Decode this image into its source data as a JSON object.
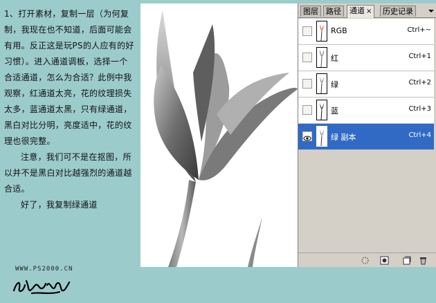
{
  "tutorial": {
    "para1": "1、打开素材，复制一层（为何复制，我现在也不知道，后面可能会有用。反正这是玩PS的人应有的好习惯）。进入通道调板，选择一个合适通道，怎么为合适？此例中我观察，红通道太亮，花的纹理损失太多，蓝通道太黑，只有绿通道，黑白对比分明，亮度适中，花的纹理也很完整。",
    "para2": "注意，我们可不是在抠图，所以并不是黑白对比越强烈的通道越合适。",
    "para3": "好了，我复制绿通道"
  },
  "watermark": "WWW.PS2000.CN",
  "panel": {
    "tabs": [
      "图层",
      "路径",
      "通道",
      "历史记录"
    ],
    "active_tab": "通道",
    "close_glyph": "×",
    "channels": [
      {
        "name": "RGB",
        "shortcut": "Ctrl+~",
        "visible": false,
        "selected": false,
        "thumb": "color"
      },
      {
        "name": "红",
        "shortcut": "Ctrl+1",
        "visible": false,
        "selected": false,
        "thumb": "light"
      },
      {
        "name": "绿",
        "shortcut": "Ctrl+2",
        "visible": false,
        "selected": false,
        "thumb": "gray"
      },
      {
        "name": "蓝",
        "shortcut": "Ctrl+3",
        "visible": false,
        "selected": false,
        "thumb": "dark"
      },
      {
        "name": "绿 副本",
        "shortcut": "Ctrl+4",
        "visible": true,
        "selected": true,
        "thumb": "gray"
      }
    ],
    "footer_buttons": [
      "load-selection-icon",
      "save-selection-icon",
      "new-channel-icon",
      "delete-channel-icon"
    ]
  },
  "colors": {
    "background": "#9ccbcc",
    "selection": "#316ac5",
    "rgb_thumb_accent": "#e8401a"
  }
}
